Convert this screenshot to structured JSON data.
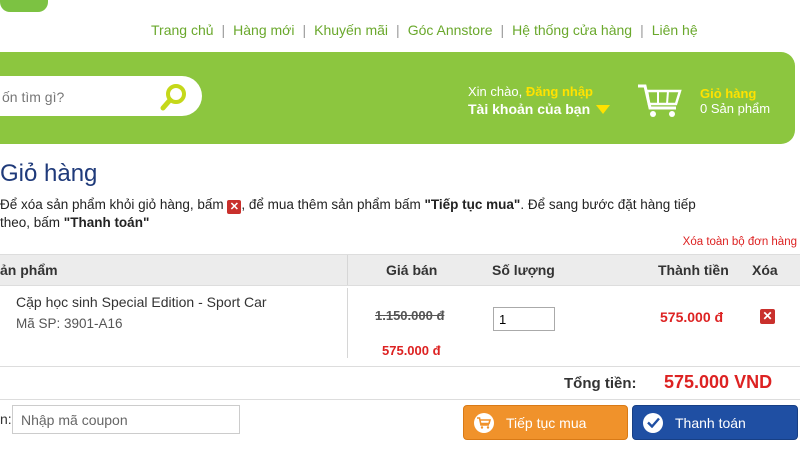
{
  "nav": {
    "items": [
      "Trang chủ",
      "Hàng mới",
      "Khuyến mãi",
      "Góc Annstore",
      "Hệ thống cửa hàng",
      "Liên hệ"
    ],
    "separator": "|"
  },
  "search": {
    "placeholder": "ốn tìm gì?"
  },
  "account": {
    "greeting": "Xin chào, ",
    "login_label": "Đăng nhập",
    "account_label": "Tài khoản của bạn"
  },
  "cart_widget": {
    "title": "Giỏ hàng",
    "count_text": "0 Sản phẩm"
  },
  "page": {
    "title": "Giỏ hàng",
    "intro_1": "Để xóa sản phẩm khỏi giỏ hàng, bấm ",
    "intro_2": ", để mua thêm sản phẩm bấm ",
    "intro_continue": "\"Tiếp tục mua\"",
    "intro_3": ". Để sang bước đặt hàng tiếp",
    "intro_4": "theo, bấm ",
    "intro_checkout": "\"Thanh toán\"",
    "clear_all": "Xóa toàn bộ đơn hàng"
  },
  "table": {
    "headers": {
      "product": "ản phẩm",
      "price": "Giá bán",
      "qty": "Số lượng",
      "subtotal": "Thành tiền",
      "delete": "Xóa"
    },
    "rows": [
      {
        "name": "Cặp học sinh Special Edition - Sport Car",
        "sku": "Mã SP: 3901-A16",
        "old_price": "1.150.000 đ",
        "price": "575.000 đ",
        "qty": "1",
        "subtotal": "575.000 đ"
      }
    ]
  },
  "total": {
    "label": "Tổng tiền:",
    "value": "575.000 VND"
  },
  "coupon": {
    "label": "n:",
    "placeholder": "Nhập mã coupon"
  },
  "buttons": {
    "continue": "Tiếp tục mua",
    "checkout": "Thanh toán"
  },
  "colors": {
    "brand_green": "#8cc63f",
    "price_red": "#dd2222",
    "title_blue": "#1f3a7a",
    "continue_orange": "#f0922b",
    "checkout_blue": "#1f4fa3"
  }
}
